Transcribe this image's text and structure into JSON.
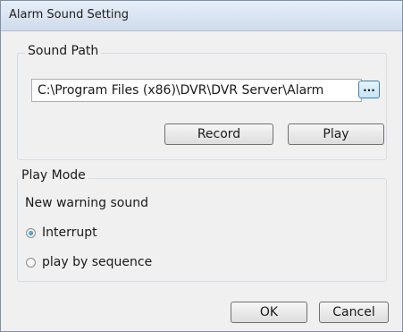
{
  "window": {
    "title": "Alarm Sound Setting"
  },
  "sound_path": {
    "legend": "Sound Path",
    "path_value": "C:\\Program Files (x86)\\DVR\\DVR Server\\Alarm",
    "browse_label": "...",
    "record_label": "Record",
    "play_label": "Play"
  },
  "play_mode": {
    "legend": "Play Mode",
    "subtitle": "New warning sound",
    "options": [
      {
        "label": "Interrupt",
        "selected": true
      },
      {
        "label": "play by sequence",
        "selected": false
      }
    ]
  },
  "footer": {
    "ok_label": "OK",
    "cancel_label": "Cancel"
  }
}
